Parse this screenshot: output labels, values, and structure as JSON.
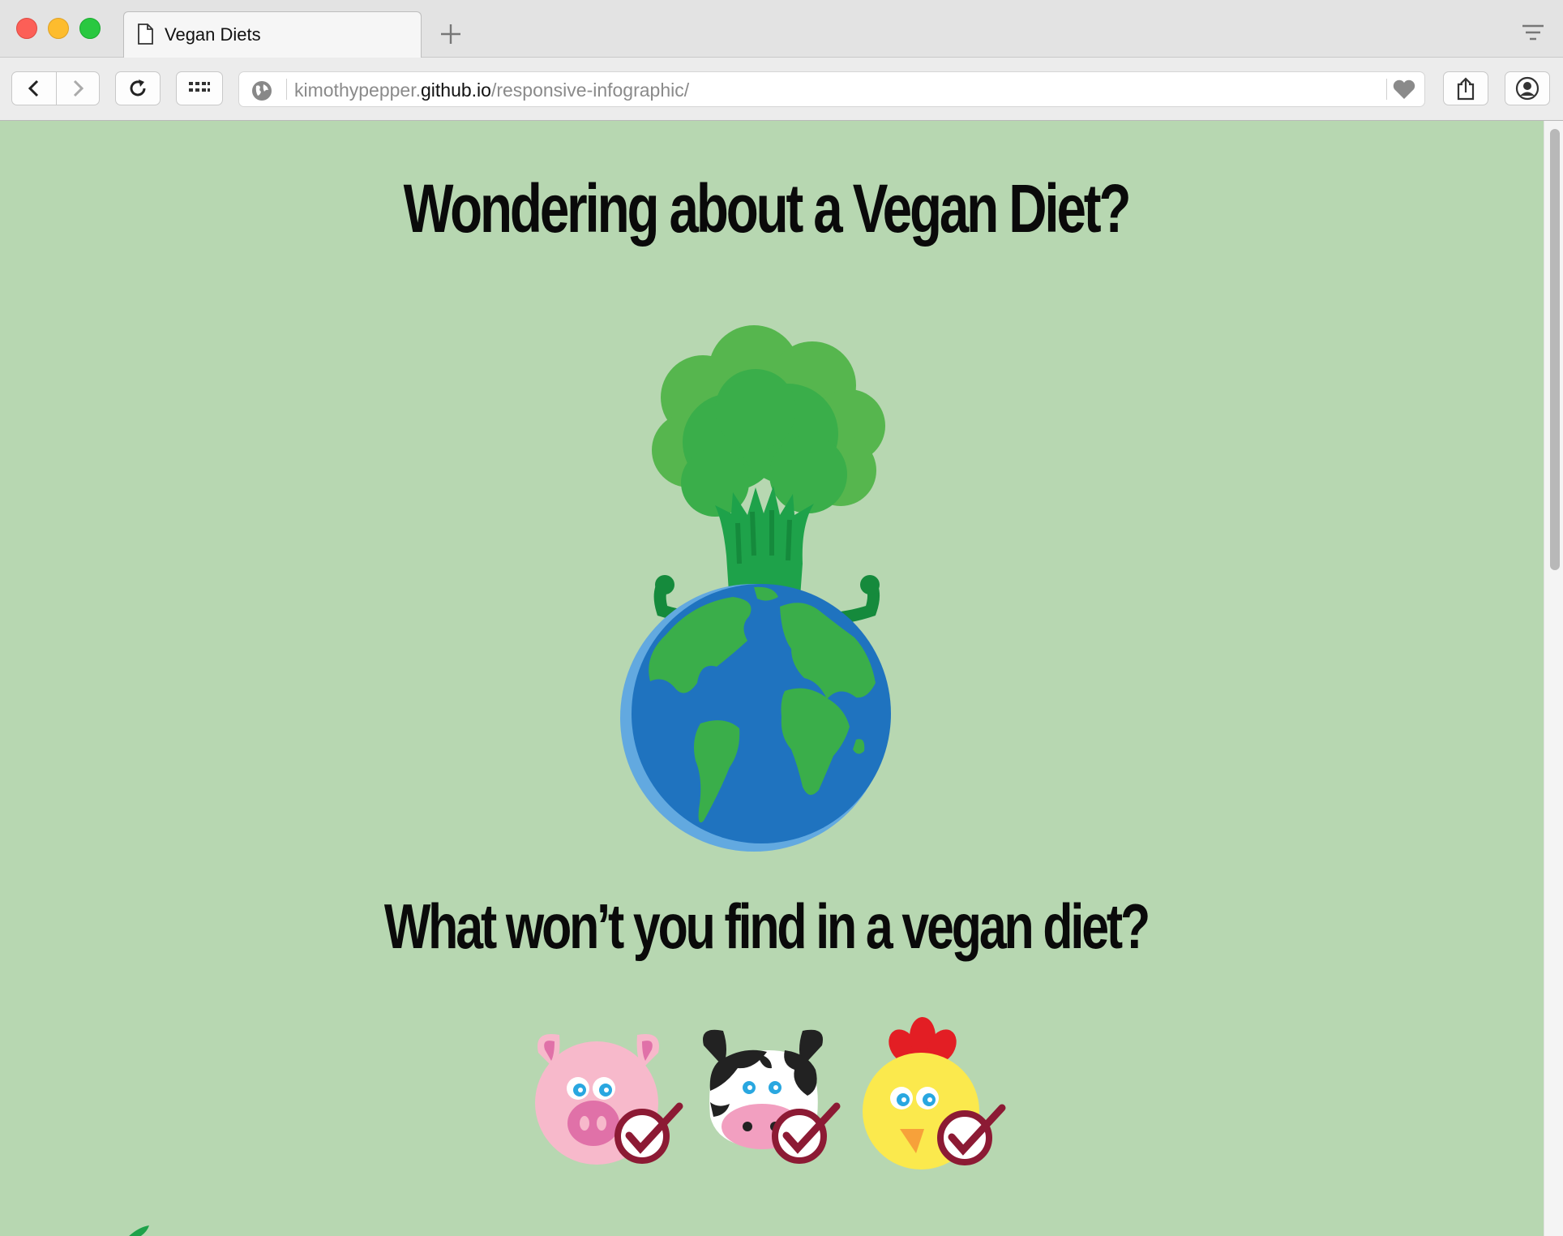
{
  "browser": {
    "tab_title": "Vegan Diets",
    "url_prefix": "kimothypepper.",
    "url_domain": "github.io",
    "url_path": "/responsive-infographic/"
  },
  "page": {
    "heading": "Wondering about a Vegan Diet?",
    "subheading": "What won’t you find in a vegan diet?",
    "animals": [
      "pig",
      "cow",
      "chicken"
    ]
  },
  "colors": {
    "background": "#b7d7b1",
    "broccoli": "#3aae4a",
    "ocean": "#1f73bf",
    "land": "#3aae4a",
    "checkmark": "#8c1a34"
  }
}
